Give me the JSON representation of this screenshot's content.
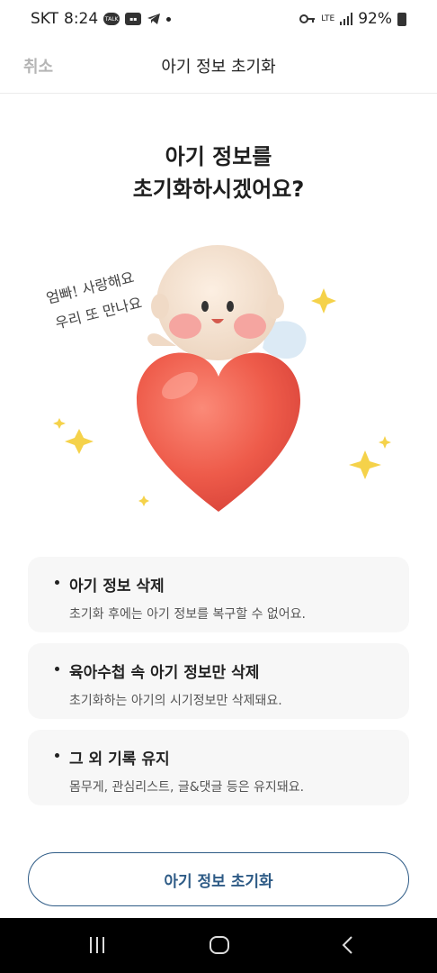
{
  "status_bar": {
    "carrier": "SKT",
    "time": "8:24",
    "network": "LTE",
    "battery": "92%"
  },
  "header": {
    "cancel_label": "취소",
    "title": "아기 정보 초기화"
  },
  "heading": {
    "line1": "아기 정보를",
    "line2": "초기화하시겠어요?"
  },
  "illustration": {
    "text_line1": "엄빠! 사랑해요",
    "text_line2": "우리 또 만나요"
  },
  "cards": [
    {
      "title": "아기 정보 삭제",
      "desc": "초기화 후에는 아기 정보를 복구할 수 없어요."
    },
    {
      "title": "육아수첩 속 아기 정보만 삭제",
      "desc": "초기화하는 아기의 시기정보만 삭제돼요."
    },
    {
      "title": "그 외 기록 유지",
      "desc": "몸무게, 관심리스트, 글&댓글 등은 유지돼요."
    }
  ],
  "button": {
    "label": "아기 정보 초기화"
  },
  "colors": {
    "accent": "#2e5b86",
    "heart": "#ee5b4a",
    "sparkle": "#f5d24a"
  }
}
